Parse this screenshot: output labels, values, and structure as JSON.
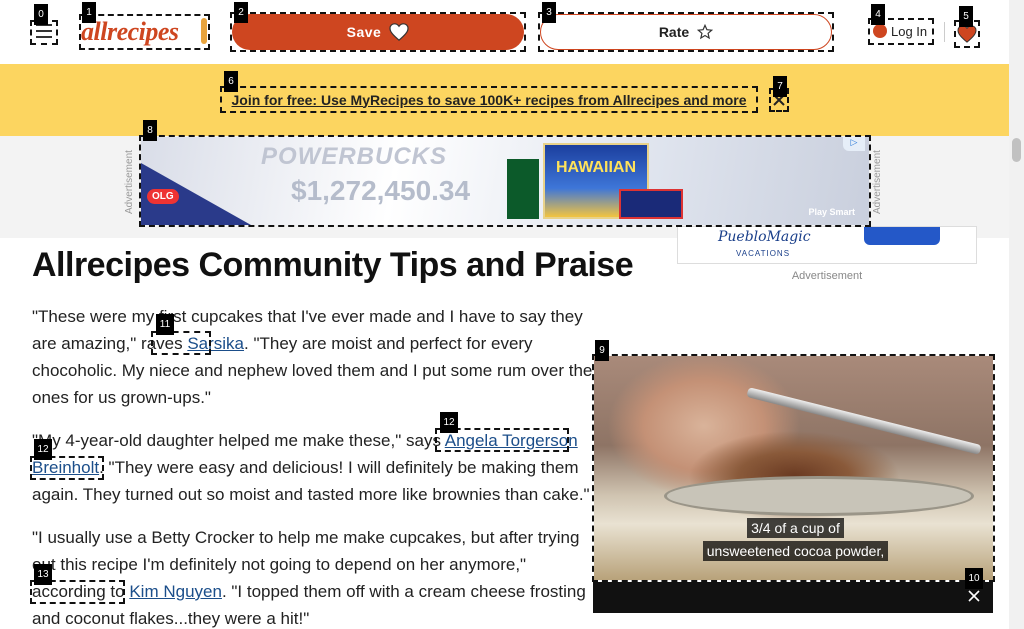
{
  "header": {
    "logo_text": "allrecipes",
    "save_label": "Save",
    "rate_label": "Rate",
    "login_label": "Log In"
  },
  "promo": {
    "text": "Join for free: Use MyRecipes to save 100K+ recipes from Allrecipes and more"
  },
  "ads": {
    "side_label": "Advertisement",
    "banner": {
      "brand": "OLG",
      "title": "POWERBUCKS",
      "amount": "$1,272,450.34",
      "tile_text": "HAWAIIAN",
      "footer": "Play Smart"
    },
    "side_ad": {
      "brand": "PuebloMagic",
      "sub": "VACATIONS"
    },
    "side_ad_label": "Advertisement"
  },
  "article": {
    "title": "Allrecipes Community Tips and Praise",
    "reviews": [
      {
        "before": "\"These were my first cupcakes that I've ever made and I have to say they are amazing,\" raves ",
        "author": "Sarsika",
        "after": ". \"They are moist and perfect for every chocoholic. My niece and nephew loved them and I put some rum over the ones for us grown-ups.\""
      },
      {
        "before": "\"My 4-year-old daughter helped me make these,\" says ",
        "author": "Angela Torgerson Breinholt",
        "after": ". \"They were easy and delicious! I will definitely be making them again. They turned out so moist and tasted more like brownies than cake.\""
      },
      {
        "before": "\"I usually use a Betty Crocker to help me make cupcakes, but after trying out this recipe I'm definitely not going to depend on her anymore,\" according to ",
        "author": "Kim Nguyen",
        "after": ". \"I topped them off with a cream cheese frosting and coconut flakes...they were a hit!\""
      }
    ]
  },
  "video": {
    "caption_line1": "3/4 of a cup of",
    "caption_line2": "unsweetened cocoa powder,"
  },
  "marks": [
    "0",
    "1",
    "2",
    "3",
    "4",
    "5",
    "6",
    "7",
    "8",
    "9",
    "10",
    "11",
    "12",
    "12",
    "13"
  ]
}
